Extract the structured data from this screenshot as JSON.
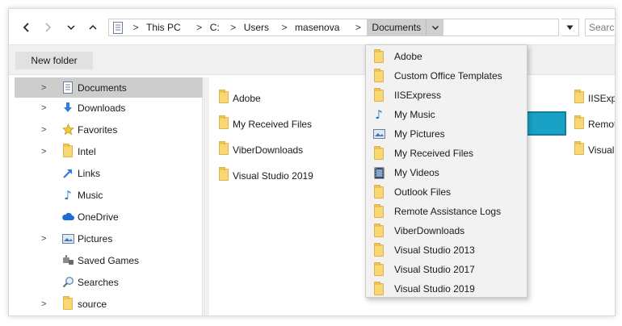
{
  "nav": {
    "back_icon": "arrow-left-icon",
    "forward_icon": "arrow-right-icon",
    "recent_icon": "chevron-down-icon",
    "up_icon": "arrow-up-icon"
  },
  "address": {
    "breadcrumbs": [
      "This PC",
      "C:",
      "Users",
      "masenova",
      "Documents"
    ],
    "current": "Documents"
  },
  "search": {
    "placeholder": "Search"
  },
  "commandbar": {
    "new_folder": "New folder"
  },
  "navpane": {
    "items": [
      {
        "label": "Documents",
        "icon": "documents-icon",
        "expandable": true,
        "selected": true
      },
      {
        "label": "Downloads",
        "icon": "download-arrow-icon",
        "expandable": true
      },
      {
        "label": "Favorites",
        "icon": "star-icon",
        "expandable": true
      },
      {
        "label": "Intel",
        "icon": "folder-icon",
        "expandable": true
      },
      {
        "label": "Links",
        "icon": "link-arrow-icon",
        "expandable": false
      },
      {
        "label": "Music",
        "icon": "music-note-icon",
        "expandable": false
      },
      {
        "label": "OneDrive",
        "icon": "cloud-icon",
        "expandable": false
      },
      {
        "label": "Pictures",
        "icon": "pictures-icon",
        "expandable": true
      },
      {
        "label": "Saved Games",
        "icon": "gamepad-icon",
        "expandable": false
      },
      {
        "label": "Searches",
        "icon": "magnifier-icon",
        "expandable": false
      },
      {
        "label": "source",
        "icon": "folder-icon",
        "expandable": true
      }
    ]
  },
  "content": {
    "column1": [
      "Adobe",
      "My Received Files",
      "ViberDownloads",
      "Visual Studio 2019"
    ],
    "column3": [
      "IISExpr",
      "Remote",
      "Visual :"
    ]
  },
  "dropdown": {
    "items": [
      {
        "label": "Adobe",
        "icon": "folder-icon"
      },
      {
        "label": "Custom Office Templates",
        "icon": "folder-icon"
      },
      {
        "label": "IISExpress",
        "icon": "folder-icon"
      },
      {
        "label": "My Music",
        "icon": "music-note-icon"
      },
      {
        "label": "My Pictures",
        "icon": "pictures-icon"
      },
      {
        "label": "My Received Files",
        "icon": "folder-icon"
      },
      {
        "label": "My Videos",
        "icon": "film-icon"
      },
      {
        "label": "Outlook Files",
        "icon": "folder-icon"
      },
      {
        "label": "Remote Assistance Logs",
        "icon": "folder-icon"
      },
      {
        "label": "ViberDownloads",
        "icon": "folder-icon"
      },
      {
        "label": "Visual Studio 2013",
        "icon": "folder-icon"
      },
      {
        "label": "Visual Studio 2017",
        "icon": "folder-icon"
      },
      {
        "label": "Visual Studio 2019",
        "icon": "folder-icon"
      }
    ]
  },
  "colors": {
    "selected_nav": "#cdcdcd",
    "dropdown_bg": "#f2f2f2",
    "tile_accent": "#19a2c5"
  }
}
